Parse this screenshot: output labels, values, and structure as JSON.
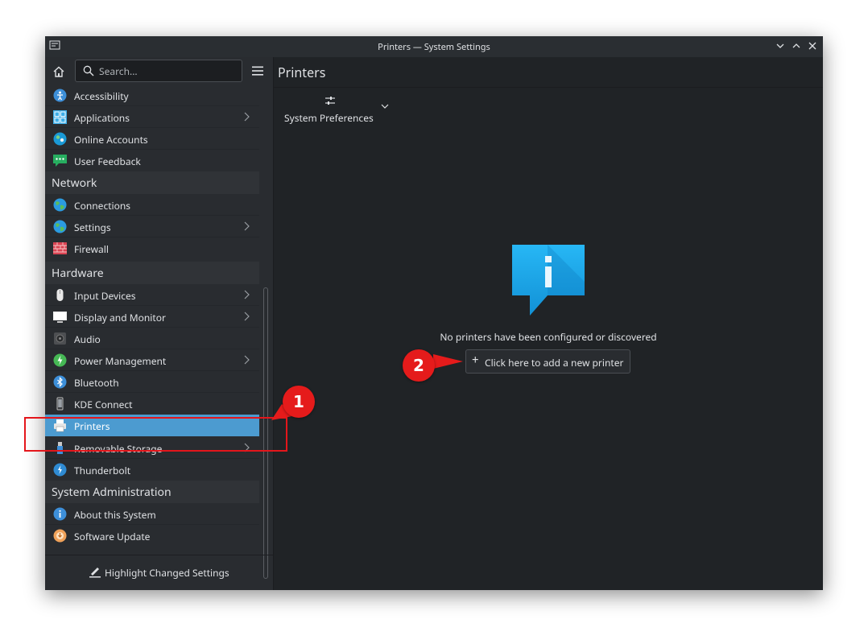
{
  "window": {
    "title": "Printers — System Settings"
  },
  "search": {
    "placeholder": "Search..."
  },
  "sidebar": {
    "items": [
      {
        "label": "Accessibility",
        "icon": "accessibility-icon",
        "chevron": false
      },
      {
        "label": "Applications",
        "icon": "applications-icon",
        "chevron": true
      },
      {
        "label": "Online Accounts",
        "icon": "online-accounts-icon",
        "chevron": false
      },
      {
        "label": "User Feedback",
        "icon": "user-feedback-icon",
        "chevron": false
      },
      {
        "header": "Network"
      },
      {
        "label": "Connections",
        "icon": "globe-icon",
        "chevron": false
      },
      {
        "label": "Settings",
        "icon": "globe-icon",
        "chevron": true
      },
      {
        "label": "Firewall",
        "icon": "firewall-icon",
        "chevron": false
      },
      {
        "header": "Hardware"
      },
      {
        "label": "Input Devices",
        "icon": "mouse-icon",
        "chevron": true
      },
      {
        "label": "Display and Monitor",
        "icon": "monitor-icon",
        "chevron": true
      },
      {
        "label": "Audio",
        "icon": "speaker-icon",
        "chevron": false
      },
      {
        "label": "Power Management",
        "icon": "power-icon",
        "chevron": true
      },
      {
        "label": "Bluetooth",
        "icon": "bluetooth-icon",
        "chevron": false
      },
      {
        "label": "KDE Connect",
        "icon": "phone-icon",
        "chevron": false
      },
      {
        "label": "Printers",
        "icon": "printer-icon",
        "chevron": false,
        "active": true
      },
      {
        "label": "Removable Storage",
        "icon": "usb-icon",
        "chevron": true
      },
      {
        "label": "Thunderbolt",
        "icon": "thunderbolt-icon",
        "chevron": false
      },
      {
        "header": "System Administration"
      },
      {
        "label": "About this System",
        "icon": "info-icon",
        "chevron": false
      },
      {
        "label": "Software Update",
        "icon": "update-icon",
        "chevron": false
      }
    ],
    "highlight_label": "Highlight Changed Settings"
  },
  "main": {
    "title": "Printers",
    "system_prefs_label": "System Preferences",
    "empty_message": "No printers have been configured or discovered",
    "add_button_label": "Click here to add a new printer"
  },
  "annotations": {
    "badge1": "1",
    "badge2": "2"
  },
  "colors": {
    "accent": "#4c9bd0",
    "window_bg": "#202326",
    "sidebar_bg": "#292c30",
    "callout_red": "#e51b1b"
  }
}
